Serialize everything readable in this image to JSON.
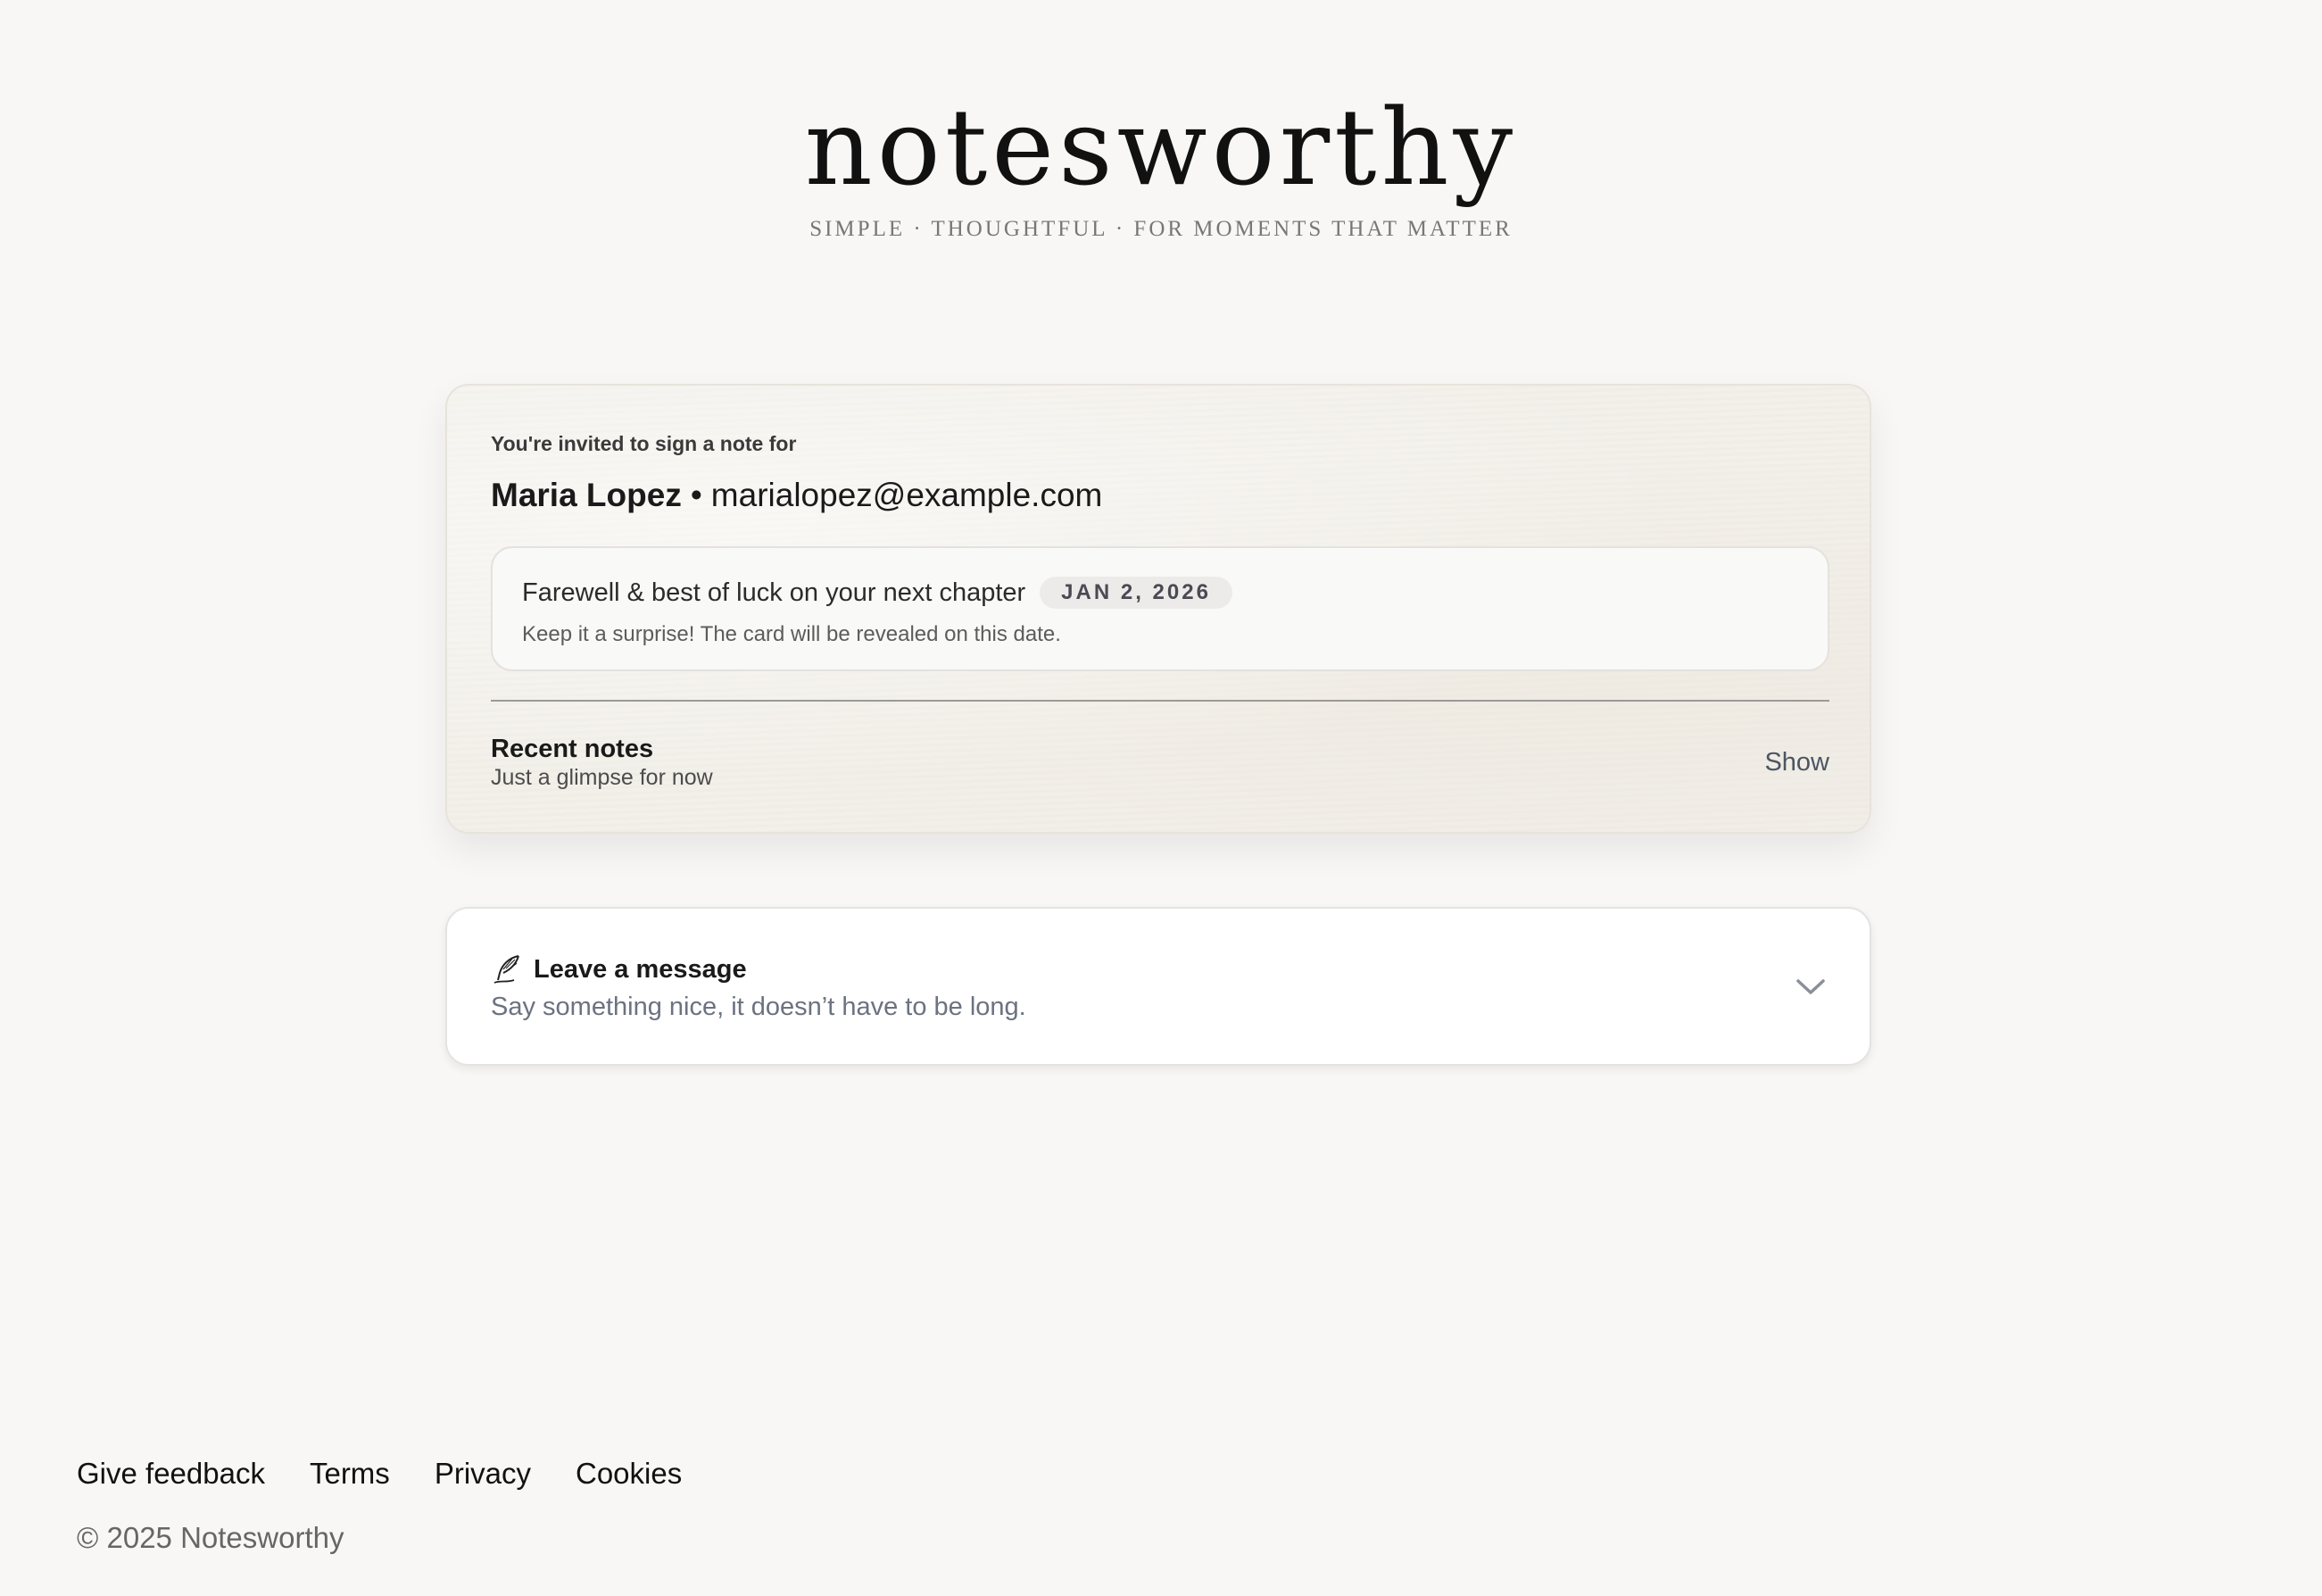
{
  "brand": {
    "title": "notesworthy",
    "tagline": "SIMPLE · THOUGHTFUL · FOR MOMENTS THAT MATTER"
  },
  "invite": {
    "eyebrow": "You're invited to sign a note for",
    "recipient_name": "Maria Lopez",
    "separator": "•",
    "recipient_email": "marialopez@example.com",
    "occasion_title": "Farewell & best of luck on your next chapter",
    "reveal_date": "JAN 2, 2026",
    "occasion_note": "Keep it a surprise! The card will be revealed on this date.",
    "recent_title": "Recent notes",
    "recent_subtitle": "Just a glimpse for now",
    "show_label": "Show"
  },
  "message": {
    "icon": "quill-icon",
    "title": "Leave a message",
    "subtitle": "Say something nice, it doesn’t have to be long.",
    "expand_icon": "chevron-down-icon"
  },
  "footer": {
    "links": [
      "Give feedback",
      "Terms",
      "Privacy",
      "Cookies"
    ],
    "copyright": "© 2025 Notesworthy"
  },
  "colors": {
    "background": "#f8f7f5",
    "card_paper": "#f3f0ea",
    "muted_text": "#6b7280"
  }
}
